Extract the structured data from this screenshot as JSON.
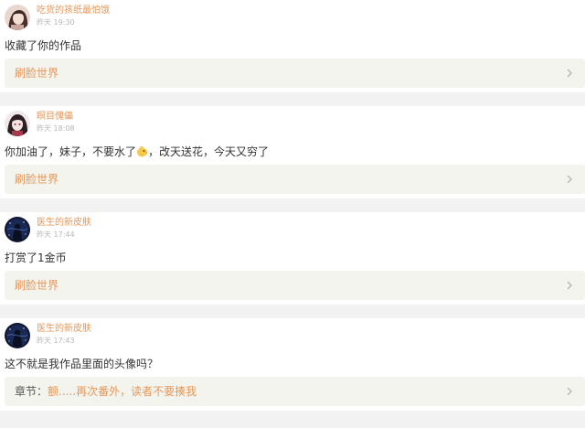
{
  "colors": {
    "username": "#e6975a",
    "timestamp": "#b8b8b8",
    "body_text": "#333333",
    "work_bg": "#f4f4ee",
    "work_link": "#e6975a",
    "page_bg": "#f2f2f2"
  },
  "feed": [
    {
      "username": "吃货的孩纸最怕饿",
      "time": "昨天 19:30",
      "text": "收藏了你的作品",
      "work": {
        "prefix": "",
        "title": "刷脸世界"
      }
    },
    {
      "username": "瞑目傀儡",
      "time": "昨天 18:08",
      "text_before_emoji": "你加油了，妹子，不要水了",
      "emoji": "chick-emoji",
      "text_after_emoji": "，改天送花，今天又穷了",
      "work": {
        "prefix": "",
        "title": "刷脸世界"
      }
    },
    {
      "username": "医生的新皮肤",
      "time": "昨天 17:44",
      "text": "打赏了1金币",
      "work": {
        "prefix": "",
        "title": "刷脸世界"
      }
    },
    {
      "username": "医生的新皮肤",
      "time": "昨天 17:43",
      "text": "这不就是我作品里面的头像吗？",
      "work": {
        "prefix": "章节：",
        "title": "额.....再次番外，读者不要揍我"
      }
    }
  ]
}
